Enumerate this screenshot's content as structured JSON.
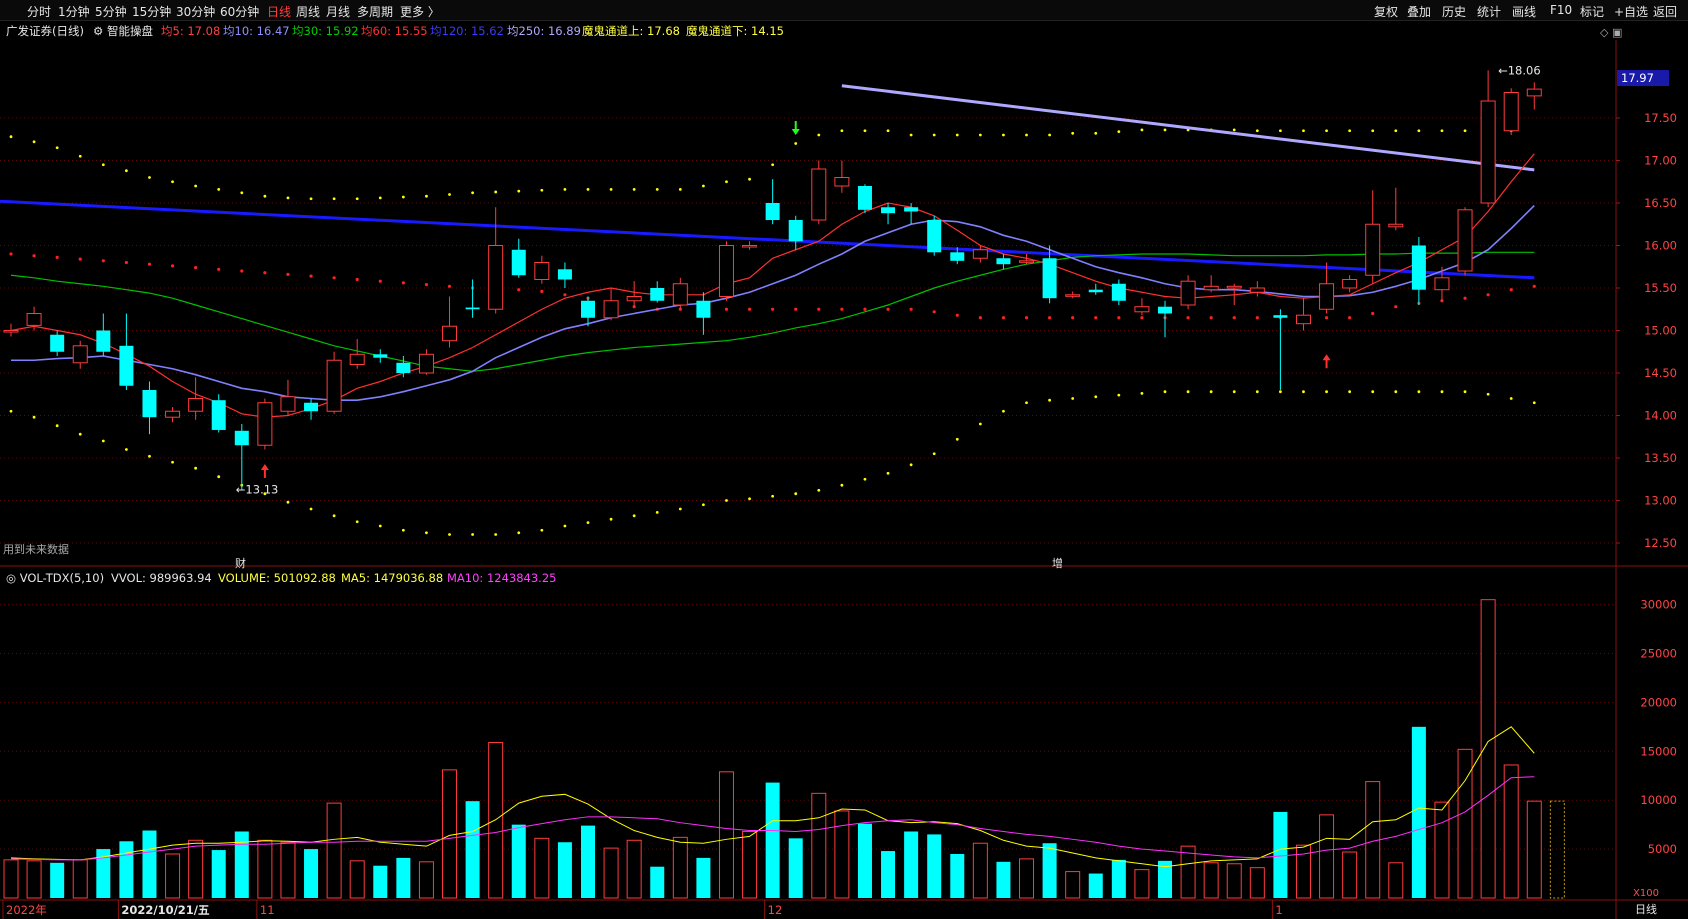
{
  "toolbar": {
    "tabs": [
      "分时",
      "1分钟",
      "5分钟",
      "15分钟",
      "30分钟",
      "60分钟",
      "日线",
      "周线",
      "月线",
      "多周期",
      "更多 〉"
    ],
    "active_tab": "日线",
    "right_buttons": [
      "复权",
      "叠加",
      "历史",
      "统计",
      "画线",
      "F10",
      "标记",
      "+自选",
      "返回"
    ]
  },
  "info_bar": {
    "title": "广发证券(日线)",
    "indicator": "智能操盘",
    "ma5": "均5: 17.08",
    "ma10": "均10: 16.47",
    "ma30": "均30: 15.92",
    "ma60": "均60: 15.55",
    "ma120": "均120: 15.62",
    "ma250": "均250: 16.89",
    "ch_up": "魔鬼通道上: 17.68",
    "ch_dn": "魔鬼通道下: 14.15"
  },
  "vol_bar": {
    "title": "VOL-TDX(5,10)",
    "vvol": "VVOL: 989963.94",
    "volume": "VOLUME: 501092.88",
    "ma5": "MA5: 1479036.88",
    "ma10": "MA10: 1243843.25"
  },
  "notes": {
    "future": "用到未来数据",
    "fin_mark": "财",
    "inc_mark": "增",
    "high_label": "18.06",
    "low_label": "13.13",
    "current_price": "17.97",
    "vol_unit": "X100",
    "period_tab": "日线"
  },
  "colors": {
    "up": "#ff3c3c",
    "down": "#00ffff",
    "ma5": "#ff3030",
    "ma10": "#8080ff",
    "ma30": "#00c000",
    "ma250": "#1a1aff",
    "ma250_trend": "#b0a8ff",
    "channel": "#ffff00",
    "red_dots": "#ff2020"
  },
  "chart_data": {
    "type": "candlestick",
    "price_axis": {
      "ticks": [
        12.5,
        13.0,
        13.5,
        14.0,
        14.5,
        15.0,
        15.5,
        16.0,
        16.5,
        17.0,
        17.5
      ],
      "range": [
        12.3,
        18.3
      ]
    },
    "volume_axis": {
      "ticks": [
        5000,
        10000,
        15000,
        20000,
        25000,
        30000
      ],
      "range": [
        0,
        32000
      ],
      "unit": "X100"
    },
    "x_labels": [
      {
        "index": 0,
        "text": "2022年"
      },
      {
        "index": 5,
        "text": "2022/10/21/五"
      },
      {
        "index": 11,
        "text": "11"
      },
      {
        "index": 33,
        "text": "12"
      },
      {
        "index": 55,
        "text": "1"
      }
    ],
    "candles": [
      {
        "o": 15.0,
        "c": 15.0,
        "h": 15.08,
        "l": 14.93,
        "v": 3900
      },
      {
        "o": 15.06,
        "c": 15.2,
        "h": 15.28,
        "l": 15.0,
        "v": 3800
      },
      {
        "o": 14.95,
        "c": 14.75,
        "h": 15.0,
        "l": 14.7,
        "v": 3600
      },
      {
        "o": 14.62,
        "c": 14.82,
        "h": 14.88,
        "l": 14.55,
        "v": 3900
      },
      {
        "o": 15.0,
        "c": 14.75,
        "h": 15.2,
        "l": 14.7,
        "v": 5000
      },
      {
        "o": 14.82,
        "c": 14.35,
        "h": 15.2,
        "l": 14.3,
        "v": 5800
      },
      {
        "o": 14.3,
        "c": 13.98,
        "h": 14.4,
        "l": 13.78,
        "v": 6900
      },
      {
        "o": 13.98,
        "c": 14.05,
        "h": 14.1,
        "l": 13.92,
        "v": 4500
      },
      {
        "o": 14.05,
        "c": 14.2,
        "h": 14.45,
        "l": 13.95,
        "v": 5900
      },
      {
        "o": 14.18,
        "c": 13.83,
        "h": 14.25,
        "l": 13.8,
        "v": 4900
      },
      {
        "o": 13.82,
        "c": 13.65,
        "h": 13.9,
        "l": 13.13,
        "v": 6800
      },
      {
        "o": 13.65,
        "c": 14.15,
        "h": 14.2,
        "l": 13.6,
        "v": 5900
      },
      {
        "o": 14.05,
        "c": 14.22,
        "h": 14.42,
        "l": 14.0,
        "v": 5700
      },
      {
        "o": 14.15,
        "c": 14.05,
        "h": 14.2,
        "l": 13.95,
        "v": 5000
      },
      {
        "o": 14.05,
        "c": 14.65,
        "h": 14.75,
        "l": 14.02,
        "v": 9700
      },
      {
        "o": 14.6,
        "c": 14.72,
        "h": 14.9,
        "l": 14.55,
        "v": 3800
      },
      {
        "o": 14.72,
        "c": 14.68,
        "h": 14.78,
        "l": 14.62,
        "v": 3300
      },
      {
        "o": 14.62,
        "c": 14.5,
        "h": 14.7,
        "l": 14.45,
        "v": 4100
      },
      {
        "o": 14.5,
        "c": 14.72,
        "h": 14.78,
        "l": 14.48,
        "v": 3700
      },
      {
        "o": 14.88,
        "c": 15.05,
        "h": 15.4,
        "l": 14.8,
        "v": 13100
      },
      {
        "o": 15.27,
        "c": 15.25,
        "h": 15.6,
        "l": 15.15,
        "v": 9900
      },
      {
        "o": 15.25,
        "c": 16.0,
        "h": 16.45,
        "l": 15.2,
        "v": 15900
      },
      {
        "o": 15.95,
        "c": 15.65,
        "h": 16.08,
        "l": 15.62,
        "v": 7500
      },
      {
        "o": 15.6,
        "c": 15.8,
        "h": 15.88,
        "l": 15.55,
        "v": 6100
      },
      {
        "o": 15.72,
        "c": 15.6,
        "h": 15.8,
        "l": 15.5,
        "v": 5700
      },
      {
        "o": 15.35,
        "c": 15.15,
        "h": 15.4,
        "l": 15.05,
        "v": 7400
      },
      {
        "o": 15.15,
        "c": 15.35,
        "h": 15.5,
        "l": 15.12,
        "v": 5100
      },
      {
        "o": 15.35,
        "c": 15.4,
        "h": 15.58,
        "l": 15.28,
        "v": 5900
      },
      {
        "o": 15.5,
        "c": 15.35,
        "h": 15.58,
        "l": 15.33,
        "v": 3200
      },
      {
        "o": 15.3,
        "c": 15.55,
        "h": 15.62,
        "l": 15.25,
        "v": 6200
      },
      {
        "o": 15.35,
        "c": 15.15,
        "h": 15.45,
        "l": 14.95,
        "v": 4100
      },
      {
        "o": 15.4,
        "c": 16.0,
        "h": 16.05,
        "l": 15.35,
        "v": 12900
      },
      {
        "o": 16.0,
        "c": 16.0,
        "h": 16.05,
        "l": 15.95,
        "v": 6800
      },
      {
        "o": 16.5,
        "c": 16.3,
        "h": 16.78,
        "l": 16.25,
        "v": 11800
      },
      {
        "o": 16.3,
        "c": 16.05,
        "h": 16.35,
        "l": 15.95,
        "v": 6100
      },
      {
        "o": 16.3,
        "c": 16.9,
        "h": 17.0,
        "l": 16.25,
        "v": 10700
      },
      {
        "o": 16.7,
        "c": 16.8,
        "h": 17.0,
        "l": 16.62,
        "v": 8900
      },
      {
        "o": 16.7,
        "c": 16.42,
        "h": 16.72,
        "l": 16.38,
        "v": 7600
      },
      {
        "o": 16.45,
        "c": 16.38,
        "h": 16.5,
        "l": 16.25,
        "v": 4800
      },
      {
        "o": 16.45,
        "c": 16.4,
        "h": 16.5,
        "l": 16.25,
        "v": 6800
      },
      {
        "o": 16.3,
        "c": 15.92,
        "h": 16.35,
        "l": 15.88,
        "v": 6500
      },
      {
        "o": 15.92,
        "c": 15.82,
        "h": 15.98,
        "l": 15.78,
        "v": 4500
      },
      {
        "o": 15.85,
        "c": 15.95,
        "h": 16.0,
        "l": 15.8,
        "v": 5600
      },
      {
        "o": 15.85,
        "c": 15.78,
        "h": 15.9,
        "l": 15.72,
        "v": 3700
      },
      {
        "o": 15.82,
        "c": 15.82,
        "h": 15.9,
        "l": 15.78,
        "v": 4000
      },
      {
        "o": 15.85,
        "c": 15.38,
        "h": 16.0,
        "l": 15.32,
        "v": 5600
      },
      {
        "o": 15.42,
        "c": 15.42,
        "h": 15.46,
        "l": 15.38,
        "v": 2700
      },
      {
        "o": 15.48,
        "c": 15.45,
        "h": 15.55,
        "l": 15.42,
        "v": 2500
      },
      {
        "o": 15.55,
        "c": 15.35,
        "h": 15.6,
        "l": 15.3,
        "v": 3900
      },
      {
        "o": 15.22,
        "c": 15.28,
        "h": 15.38,
        "l": 15.18,
        "v": 2900
      },
      {
        "o": 15.28,
        "c": 15.2,
        "h": 15.35,
        "l": 14.92,
        "v": 3800
      },
      {
        "o": 15.3,
        "c": 15.58,
        "h": 15.65,
        "l": 15.25,
        "v": 5300
      },
      {
        "o": 15.48,
        "c": 15.52,
        "h": 15.65,
        "l": 15.45,
        "v": 3600
      },
      {
        "o": 15.5,
        "c": 15.52,
        "h": 15.55,
        "l": 15.3,
        "v": 3500
      },
      {
        "o": 15.45,
        "c": 15.5,
        "h": 15.58,
        "l": 15.4,
        "v": 3100
      },
      {
        "o": 15.18,
        "c": 15.15,
        "h": 15.25,
        "l": 14.3,
        "v": 8800
      },
      {
        "o": 15.08,
        "c": 15.18,
        "h": 15.38,
        "l": 15.0,
        "v": 5400
      },
      {
        "o": 15.25,
        "c": 15.55,
        "h": 15.8,
        "l": 15.2,
        "v": 8500
      },
      {
        "o": 15.5,
        "c": 15.6,
        "h": 15.65,
        "l": 15.45,
        "v": 4700
      },
      {
        "o": 15.65,
        "c": 16.25,
        "h": 16.65,
        "l": 15.55,
        "v": 11900
      },
      {
        "o": 16.22,
        "c": 16.25,
        "h": 16.68,
        "l": 16.18,
        "v": 3600
      },
      {
        "o": 16.0,
        "c": 15.48,
        "h": 16.1,
        "l": 15.3,
        "v": 17500
      },
      {
        "o": 15.48,
        "c": 15.62,
        "h": 15.75,
        "l": 15.35,
        "v": 9800
      },
      {
        "o": 15.7,
        "c": 16.42,
        "h": 16.45,
        "l": 15.65,
        "v": 15200
      },
      {
        "o": 16.5,
        "c": 17.7,
        "h": 18.06,
        "l": 16.45,
        "v": 30500
      },
      {
        "o": 17.35,
        "c": 17.8,
        "h": 17.85,
        "l": 17.3,
        "v": 13600
      },
      {
        "o": 17.76,
        "c": 17.84,
        "h": 17.92,
        "l": 17.6,
        "v": 9900
      }
    ],
    "ma5": [
      15.0,
      15.05,
      15.0,
      14.95,
      14.85,
      14.72,
      14.58,
      14.4,
      14.25,
      14.15,
      14.02,
      13.98,
      14.0,
      14.08,
      14.18,
      14.32,
      14.4,
      14.5,
      14.58,
      14.68,
      14.8,
      14.95,
      15.1,
      15.25,
      15.38,
      15.45,
      15.5,
      15.45,
      15.42,
      15.42,
      15.42,
      15.55,
      15.62,
      15.85,
      15.95,
      16.05,
      16.25,
      16.4,
      16.5,
      16.45,
      16.35,
      16.18,
      16.0,
      15.9,
      15.85,
      15.78,
      15.68,
      15.58,
      15.5,
      15.45,
      15.4,
      15.38,
      15.4,
      15.42,
      15.45,
      15.4,
      15.38,
      15.4,
      15.42,
      15.55,
      15.68,
      15.8,
      15.95,
      16.1,
      16.4,
      16.75,
      17.08
    ],
    "ma10": [
      14.65,
      14.65,
      14.67,
      14.68,
      14.7,
      14.65,
      14.6,
      14.55,
      14.48,
      14.4,
      14.32,
      14.28,
      14.22,
      14.2,
      14.18,
      14.18,
      14.22,
      14.28,
      14.35,
      14.42,
      14.52,
      14.68,
      14.8,
      14.92,
      15.02,
      15.08,
      15.15,
      15.2,
      15.25,
      15.3,
      15.32,
      15.38,
      15.45,
      15.55,
      15.65,
      15.78,
      15.9,
      16.05,
      16.15,
      16.25,
      16.3,
      16.28,
      16.22,
      16.12,
      16.05,
      15.95,
      15.85,
      15.75,
      15.68,
      15.62,
      15.55,
      15.5,
      15.48,
      15.48,
      15.46,
      15.43,
      15.4,
      15.4,
      15.41,
      15.45,
      15.52,
      15.6,
      15.7,
      15.8,
      15.95,
      16.2,
      16.47
    ],
    "ma30": [
      15.65,
      15.62,
      15.58,
      15.55,
      15.52,
      15.48,
      15.44,
      15.38,
      15.3,
      15.22,
      15.14,
      15.06,
      14.98,
      14.9,
      14.82,
      14.76,
      14.7,
      14.64,
      14.58,
      14.55,
      14.52,
      14.55,
      14.6,
      14.65,
      14.7,
      14.74,
      14.77,
      14.8,
      14.82,
      14.84,
      14.86,
      14.88,
      14.92,
      14.97,
      15.03,
      15.08,
      15.14,
      15.22,
      15.3,
      15.4,
      15.5,
      15.58,
      15.65,
      15.72,
      15.78,
      15.82,
      15.86,
      15.88,
      15.89,
      15.9,
      15.9,
      15.9,
      15.89,
      15.88,
      15.88,
      15.88,
      15.88,
      15.89,
      15.89,
      15.9,
      15.9,
      15.91,
      15.91,
      15.91,
      15.92,
      15.92,
      15.92
    ],
    "ma250_trend": {
      "from": {
        "index": 36,
        "value": 17.88
      },
      "to": {
        "index": 66,
        "value": 16.89
      }
    },
    "ma250_blue": {
      "from": {
        "index": 0,
        "value": 16.52
      },
      "to": {
        "index": 66,
        "value": 15.62
      }
    },
    "vol_ma5": [
      4100,
      4000,
      3950,
      3900,
      4200,
      4600,
      5000,
      5400,
      5600,
      5600,
      5700,
      5850,
      5800,
      5700,
      6000,
      6200,
      5700,
      5500,
      5300,
      6400,
      6800,
      8000,
      9700,
      10400,
      10600,
      9600,
      8100,
      6900,
      6200,
      5700,
      5600,
      6000,
      6300,
      7900,
      7900,
      8200,
      9100,
      9000,
      7900,
      7700,
      7800,
      7600,
      6900,
      5900,
      5300,
      5100,
      4600,
      4100,
      3800,
      3500,
      3200,
      3500,
      3800,
      3900,
      4000,
      5000,
      5200,
      6100,
      6000,
      7800,
      8000,
      9200,
      9000,
      12000,
      16000,
      17500,
      14800
    ],
    "vol_ma10": [
      4000,
      3950,
      3900,
      3900,
      4100,
      4400,
      4700,
      5000,
      5300,
      5400,
      5500,
      5500,
      5600,
      5700,
      5700,
      5800,
      5800,
      5800,
      5800,
      6100,
      6400,
      6700,
      7200,
      7600,
      8000,
      8300,
      8300,
      8200,
      8100,
      7700,
      7400,
      7100,
      6900,
      6900,
      6800,
      7000,
      7400,
      7700,
      7900,
      8000,
      7700,
      7500,
      7100,
      6800,
      6500,
      6300,
      6000,
      5700,
      5300,
      5000,
      4800,
      4600,
      4400,
      4200,
      4100,
      4300,
      4500,
      4900,
      5100,
      5800,
      6300,
      7000,
      7700,
      8800,
      10500,
      12300,
      12400
    ]
  }
}
